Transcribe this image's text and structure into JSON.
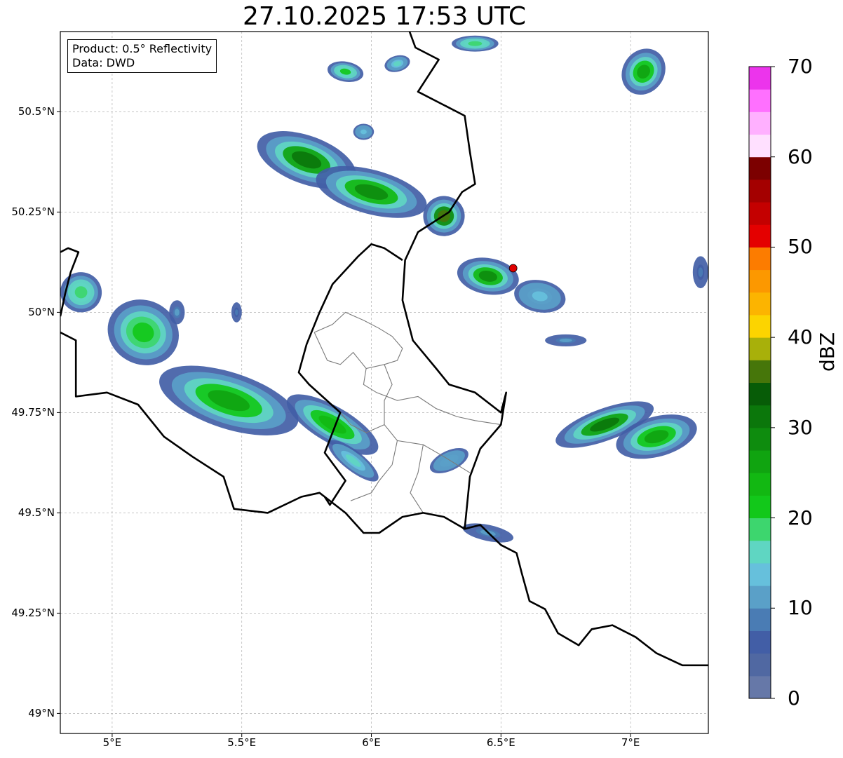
{
  "title": "27.10.2025 17:53 UTC",
  "info": {
    "product": "Product: 0.5° Reflectivity",
    "data": "Data: DWD"
  },
  "latitude_ticks": [
    {
      "label": "50.5°N",
      "value": 50.5
    },
    {
      "label": "50.25°N",
      "value": 50.25
    },
    {
      "label": "50°N",
      "value": 50.0
    },
    {
      "label": "49.75°N",
      "value": 49.75
    },
    {
      "label": "49.5°N",
      "value": 49.5
    },
    {
      "label": "49.25°N",
      "value": 49.25
    },
    {
      "label": "49°N",
      "value": 49.0
    }
  ],
  "longitude_ticks": [
    {
      "label": "5°E",
      "value": 5.0
    },
    {
      "label": "5.5°E",
      "value": 5.5
    },
    {
      "label": "6°E",
      "value": 6.0
    },
    {
      "label": "6.5°E",
      "value": 6.5
    },
    {
      "label": "7°E",
      "value": 7.0
    }
  ],
  "map_extent": {
    "lon_min": 4.8,
    "lon_max": 7.3,
    "lat_min": 48.95,
    "lat_max": 50.7
  },
  "colorbar": {
    "unit": "dBZ",
    "min": 0,
    "max": 70,
    "ticks": [
      {
        "label": "0",
        "value": 0
      },
      {
        "label": "10",
        "value": 10
      },
      {
        "label": "20",
        "value": 20
      },
      {
        "label": "30",
        "value": 30
      },
      {
        "label": "40",
        "value": 40
      },
      {
        "label": "50",
        "value": 50
      },
      {
        "label": "60",
        "value": 60
      },
      {
        "label": "70",
        "value": 70
      }
    ],
    "colors": [
      "#6678a8",
      "#5068a2",
      "#425ea6",
      "#4a7cb4",
      "#5aa0c8",
      "#66c0dc",
      "#5fd6c2",
      "#3dd66e",
      "#12c81a",
      "#12b812",
      "#10a410",
      "#0e8c0e",
      "#0b770b",
      "#075c07",
      "#46760a",
      "#a8b00a",
      "#fcd400",
      "#fcb400",
      "#fc9800",
      "#fc7c00",
      "#e40000",
      "#c40000",
      "#a40000",
      "#7c0000",
      "#ffe0ff",
      "#ffb0ff",
      "#ff70ff",
      "#ec34ec"
    ]
  },
  "radar_marker": {
    "lon": 6.547,
    "lat": 50.11,
    "color": "#e00000"
  },
  "precip_cells": [
    {
      "lon": 5.12,
      "lat": 49.95,
      "rx": 0.14,
      "ry": 0.08,
      "rot": 25,
      "intensity": 22
    },
    {
      "lon": 5.45,
      "lat": 49.78,
      "rx": 0.28,
      "ry": 0.07,
      "rot": 18,
      "intensity": 26
    },
    {
      "lon": 5.85,
      "lat": 49.72,
      "rx": 0.2,
      "ry": 0.045,
      "rot": 30,
      "intensity": 24
    },
    {
      "lon": 5.93,
      "lat": 49.63,
      "rx": 0.12,
      "ry": 0.025,
      "rot": 38,
      "intensity": 15
    },
    {
      "lon": 4.88,
      "lat": 50.05,
      "rx": 0.08,
      "ry": 0.05,
      "rot": 10,
      "intensity": 18
    },
    {
      "lon": 5.75,
      "lat": 50.38,
      "rx": 0.2,
      "ry": 0.06,
      "rot": 20,
      "intensity": 30
    },
    {
      "lon": 6.0,
      "lat": 50.3,
      "rx": 0.22,
      "ry": 0.055,
      "rot": 15,
      "intensity": 28
    },
    {
      "lon": 6.28,
      "lat": 50.24,
      "rx": 0.08,
      "ry": 0.05,
      "rot": 0,
      "intensity": 35
    },
    {
      "lon": 5.9,
      "lat": 50.6,
      "rx": 0.07,
      "ry": 0.025,
      "rot": 10,
      "intensity": 20
    },
    {
      "lon": 6.1,
      "lat": 50.62,
      "rx": 0.05,
      "ry": 0.02,
      "rot": -15,
      "intensity": 15
    },
    {
      "lon": 6.4,
      "lat": 50.67,
      "rx": 0.09,
      "ry": 0.02,
      "rot": 0,
      "intensity": 18
    },
    {
      "lon": 6.45,
      "lat": 50.09,
      "rx": 0.12,
      "ry": 0.045,
      "rot": 10,
      "intensity": 28
    },
    {
      "lon": 6.65,
      "lat": 50.04,
      "rx": 0.1,
      "ry": 0.04,
      "rot": 10,
      "intensity": 14
    },
    {
      "lon": 7.05,
      "lat": 50.6,
      "rx": 0.08,
      "ry": 0.06,
      "rot": 35,
      "intensity": 26
    },
    {
      "lon": 6.9,
      "lat": 49.72,
      "rx": 0.2,
      "ry": 0.04,
      "rot": -20,
      "intensity": 30
    },
    {
      "lon": 7.1,
      "lat": 49.69,
      "rx": 0.16,
      "ry": 0.05,
      "rot": -15,
      "intensity": 25
    },
    {
      "lon": 6.3,
      "lat": 49.63,
      "rx": 0.08,
      "ry": 0.025,
      "rot": -25,
      "intensity": 12
    },
    {
      "lon": 6.45,
      "lat": 49.45,
      "rx": 0.1,
      "ry": 0.02,
      "rot": 12,
      "intensity": 10
    },
    {
      "lon": 6.75,
      "lat": 49.93,
      "rx": 0.08,
      "ry": 0.015,
      "rot": 0,
      "intensity": 10
    },
    {
      "lon": 7.27,
      "lat": 50.1,
      "rx": 0.03,
      "ry": 0.04,
      "rot": 0,
      "intensity": 8
    },
    {
      "lon": 5.48,
      "lat": 50.0,
      "rx": 0.02,
      "ry": 0.025,
      "rot": 0,
      "intensity": 8
    },
    {
      "lon": 5.25,
      "lat": 50.0,
      "rx": 0.03,
      "ry": 0.03,
      "rot": 0,
      "intensity": 10
    },
    {
      "lon": 5.97,
      "lat": 50.45,
      "rx": 0.04,
      "ry": 0.02,
      "rot": 0,
      "intensity": 14
    }
  ],
  "borders": {
    "national": [
      [
        [
          6.13,
          50.73
        ],
        [
          6.17,
          50.66
        ],
        [
          6.26,
          50.63
        ],
        [
          6.18,
          50.55
        ],
        [
          6.36,
          50.49
        ],
        [
          6.38,
          50.4
        ],
        [
          6.4,
          50.32
        ],
        [
          6.35,
          50.3
        ],
        [
          6.3,
          50.25
        ],
        [
          6.18,
          50.2
        ],
        [
          6.13,
          50.13
        ],
        [
          6.12,
          50.03
        ],
        [
          6.16,
          49.93
        ],
        [
          6.25,
          49.86
        ],
        [
          6.3,
          49.82
        ],
        [
          6.4,
          49.8
        ],
        [
          6.5,
          49.75
        ],
        [
          6.52,
          49.8
        ],
        [
          6.5,
          49.72
        ],
        [
          6.42,
          49.66
        ],
        [
          6.38,
          49.59
        ],
        [
          6.36,
          49.46
        ],
        [
          6.28,
          49.49
        ],
        [
          6.2,
          49.5
        ],
        [
          6.12,
          49.49
        ],
        [
          6.03,
          49.45
        ],
        [
          5.97,
          49.45
        ],
        [
          5.9,
          49.5
        ],
        [
          5.82,
          49.54
        ],
        [
          5.8,
          49.55
        ],
        [
          5.73,
          49.54
        ],
        [
          5.6,
          49.5
        ],
        [
          5.47,
          49.51
        ],
        [
          5.43,
          49.59
        ],
        [
          5.31,
          49.64
        ],
        [
          5.2,
          49.69
        ],
        [
          5.1,
          49.77
        ],
        [
          4.98,
          49.8
        ],
        [
          4.86,
          49.79
        ],
        [
          4.86,
          49.93
        ],
        [
          4.8,
          49.95
        ]
      ],
      [
        [
          4.8,
          50.15
        ],
        [
          4.83,
          50.16
        ],
        [
          4.87,
          50.15
        ],
        [
          4.84,
          50.1
        ],
        [
          4.82,
          50.05
        ],
        [
          4.8,
          49.99
        ]
      ],
      [
        [
          6.36,
          49.46
        ],
        [
          6.42,
          49.47
        ],
        [
          6.5,
          49.42
        ],
        [
          6.56,
          49.4
        ],
        [
          6.58,
          49.35
        ],
        [
          6.61,
          49.28
        ],
        [
          6.67,
          49.26
        ],
        [
          6.72,
          49.2
        ],
        [
          6.8,
          49.17
        ],
        [
          6.85,
          49.21
        ],
        [
          6.93,
          49.22
        ],
        [
          7.02,
          49.19
        ],
        [
          7.1,
          49.15
        ],
        [
          7.2,
          49.12
        ],
        [
          7.3,
          49.12
        ]
      ],
      [
        [
          6.12,
          50.13
        ],
        [
          6.05,
          50.16
        ],
        [
          6.0,
          50.17
        ],
        [
          5.95,
          50.14
        ],
        [
          5.85,
          50.07
        ],
        [
          5.8,
          50.0
        ],
        [
          5.75,
          49.92
        ],
        [
          5.72,
          49.85
        ],
        [
          5.76,
          49.82
        ],
        [
          5.88,
          49.75
        ],
        [
          5.82,
          49.65
        ],
        [
          5.9,
          49.58
        ],
        [
          5.84,
          49.52
        ],
        [
          5.82,
          49.54
        ]
      ]
    ],
    "district": [
      [
        [
          5.78,
          49.95
        ],
        [
          5.85,
          49.97
        ],
        [
          5.9,
          50.0
        ],
        [
          5.97,
          49.98
        ],
        [
          6.03,
          49.96
        ],
        [
          6.08,
          49.94
        ],
        [
          6.12,
          49.91
        ],
        [
          6.1,
          49.88
        ],
        [
          6.05,
          49.87
        ],
        [
          5.98,
          49.86
        ],
        [
          5.93,
          49.9
        ],
        [
          5.88,
          49.87
        ],
        [
          5.83,
          49.88
        ],
        [
          5.78,
          49.95
        ]
      ],
      [
        [
          5.98,
          49.86
        ],
        [
          5.97,
          49.82
        ],
        [
          6.02,
          49.8
        ],
        [
          6.1,
          49.78
        ],
        [
          6.18,
          49.79
        ],
        [
          6.25,
          49.76
        ],
        [
          6.33,
          49.74
        ],
        [
          6.4,
          49.73
        ],
        [
          6.5,
          49.72
        ]
      ],
      [
        [
          6.05,
          49.87
        ],
        [
          6.08,
          49.82
        ],
        [
          6.05,
          49.78
        ],
        [
          6.05,
          49.72
        ],
        [
          6.1,
          49.68
        ],
        [
          6.2,
          49.67
        ],
        [
          6.28,
          49.64
        ],
        [
          6.38,
          49.6
        ]
      ],
      [
        [
          6.05,
          49.72
        ],
        [
          5.98,
          49.7
        ],
        [
          5.92,
          49.72
        ],
        [
          5.88,
          49.75
        ]
      ],
      [
        [
          6.1,
          49.68
        ],
        [
          6.08,
          49.62
        ],
        [
          6.03,
          49.58
        ],
        [
          6.0,
          49.55
        ],
        [
          5.92,
          49.53
        ]
      ],
      [
        [
          6.2,
          49.67
        ],
        [
          6.18,
          49.6
        ],
        [
          6.15,
          49.55
        ],
        [
          6.2,
          49.5
        ]
      ]
    ]
  }
}
